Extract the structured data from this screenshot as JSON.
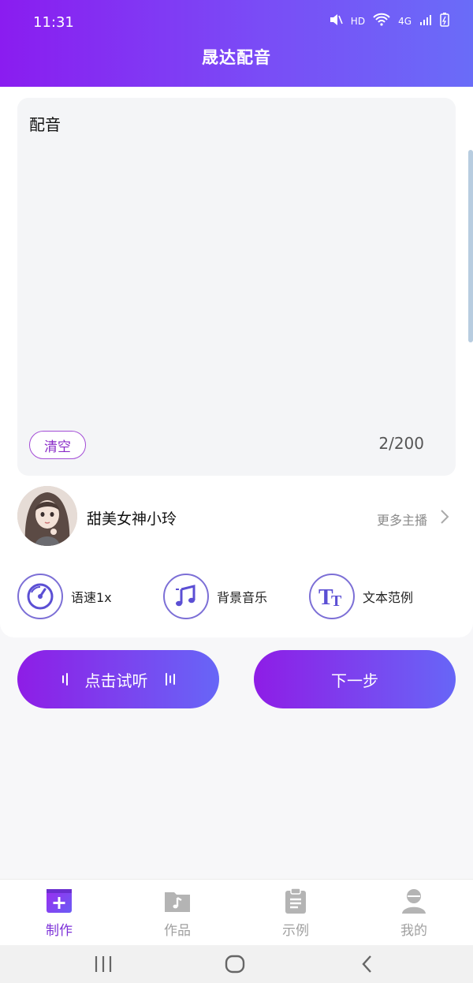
{
  "status_bar": {
    "time": "11:31",
    "network": "HD",
    "network_type": "4G"
  },
  "header": {
    "title": "晟达配音"
  },
  "editor": {
    "text": "配音",
    "clear_label": "清空",
    "counter": "2/200"
  },
  "voice": {
    "name": "甜美女神小玲",
    "more_label": "更多主播"
  },
  "options": [
    {
      "label": "语速1x",
      "icon": "speedometer-icon"
    },
    {
      "label": "背景音乐",
      "icon": "music-note-icon"
    },
    {
      "label": "文本范例",
      "icon": "text-tt-icon"
    }
  ],
  "actions": {
    "listen_label": "点击试听",
    "next_label": "下一步"
  },
  "tabs": [
    {
      "label": "制作",
      "icon": "add-box-icon",
      "active": true
    },
    {
      "label": "作品",
      "icon": "folder-music-icon",
      "active": false
    },
    {
      "label": "示例",
      "icon": "clipboard-icon",
      "active": false
    },
    {
      "label": "我的",
      "icon": "person-icon",
      "active": false
    }
  ],
  "colors": {
    "accent": "#7d32d8",
    "gradient_start": "#8a1cf0",
    "gradient_end": "#6a6cf8",
    "icon_ring": "#7c6fd6"
  }
}
